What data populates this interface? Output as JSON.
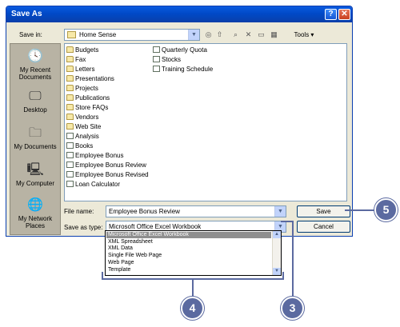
{
  "window": {
    "title": "Save As",
    "help_glyph": "?",
    "close_glyph": "✕"
  },
  "savein": {
    "label": "Save in:",
    "value": "Home Sense"
  },
  "toolbar": {
    "tools_label": "Tools ▾"
  },
  "places": [
    {
      "label": "My Recent Documents",
      "icon": "recent-documents-icon"
    },
    {
      "label": "Desktop",
      "icon": "desktop-icon"
    },
    {
      "label": "My Documents",
      "icon": "my-documents-icon"
    },
    {
      "label": "My Computer",
      "icon": "my-computer-icon"
    },
    {
      "label": "My Network Places",
      "icon": "network-places-icon"
    }
  ],
  "files_col1": [
    {
      "name": "Budgets",
      "type": "folder"
    },
    {
      "name": "Fax",
      "type": "folder"
    },
    {
      "name": "Letters",
      "type": "folder"
    },
    {
      "name": "Presentations",
      "type": "folder"
    },
    {
      "name": "Projects",
      "type": "folder"
    },
    {
      "name": "Publications",
      "type": "folder"
    },
    {
      "name": "Store FAQs",
      "type": "folder"
    },
    {
      "name": "Vendors",
      "type": "folder"
    },
    {
      "name": "Web Site",
      "type": "folder"
    },
    {
      "name": "Analysis",
      "type": "workbook"
    },
    {
      "name": "Books",
      "type": "workbook"
    },
    {
      "name": "Employee Bonus",
      "type": "workbook"
    },
    {
      "name": "Employee Bonus Review",
      "type": "workbook"
    },
    {
      "name": "Employee Bonus Revised",
      "type": "workbook"
    },
    {
      "name": "Loan Calculator",
      "type": "workbook"
    }
  ],
  "files_col2": [
    {
      "name": "Quarterly Quota",
      "type": "workbook"
    },
    {
      "name": "Stocks",
      "type": "workbook"
    },
    {
      "name": "Training Schedule",
      "type": "workbook"
    }
  ],
  "filename": {
    "label": "File name:",
    "value": "Employee Bonus Review"
  },
  "savetype": {
    "label": "Save as type:",
    "value": "Microsoft Office Excel Workbook",
    "options": [
      "Microsoft Office Excel Workbook",
      "XML Spreadsheet",
      "XML Data",
      "Single File Web Page",
      "Web Page",
      "Template"
    ]
  },
  "buttons": {
    "save": "Save",
    "cancel": "Cancel"
  },
  "callouts": {
    "c5": "5",
    "c4": "4",
    "c3": "3"
  },
  "colors": {
    "callout": "#5b6aa0",
    "titlebar": "#0a5adf"
  }
}
